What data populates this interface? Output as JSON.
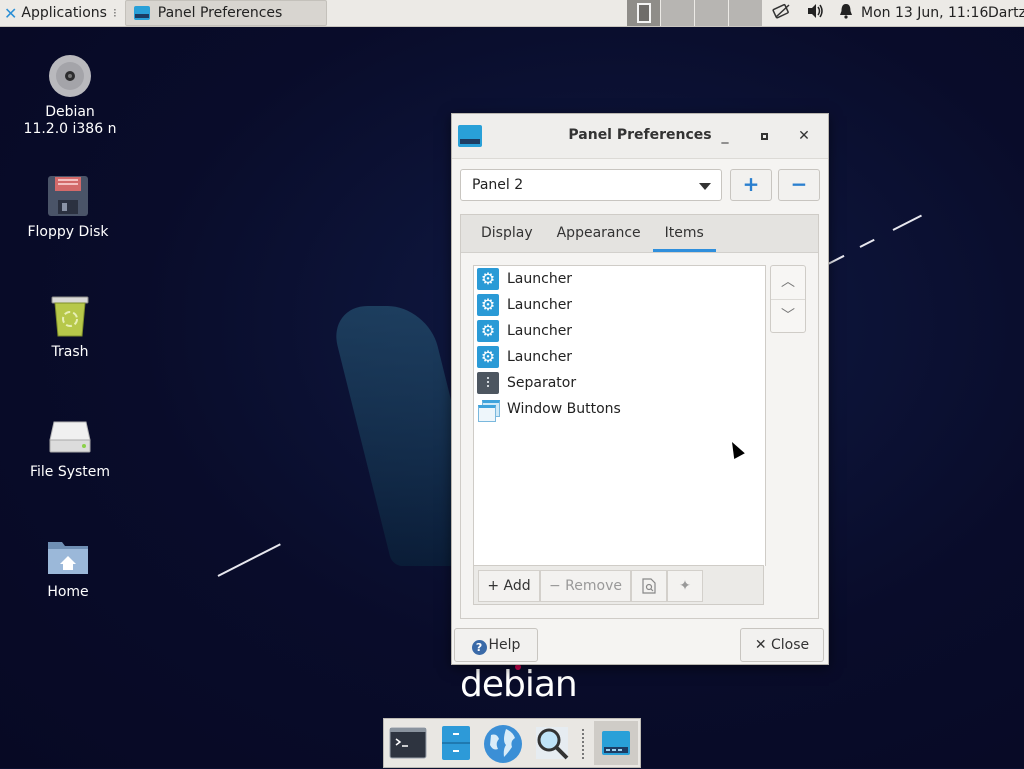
{
  "top_panel": {
    "applications_label": "Applications",
    "task_title": "Panel Preferences",
    "clock": "Mon 13 Jun, 11:16",
    "user": "Dartz",
    "tray_icons": [
      "network-icon",
      "volume-icon",
      "notification-bell-icon"
    ]
  },
  "desktop": {
    "icons": [
      {
        "label": "Debian\n11.2.0 i386 n",
        "icon": "disc-icon"
      },
      {
        "label": "Floppy Disk",
        "icon": "floppy-icon"
      },
      {
        "label": "Trash",
        "icon": "trash-icon"
      },
      {
        "label": "File System",
        "icon": "drive-icon"
      },
      {
        "label": "Home",
        "icon": "home-folder-icon"
      }
    ],
    "wallpaper_text": "debian"
  },
  "dialog": {
    "title": "Panel Preferences",
    "panel_select_value": "Panel 2",
    "add_panel_symbol": "+",
    "remove_panel_symbol": "−",
    "tabs": [
      {
        "label": "Display",
        "active": false
      },
      {
        "label": "Appearance",
        "active": false
      },
      {
        "label": "Items",
        "active": true
      }
    ],
    "items": [
      {
        "label": "Launcher",
        "icon": "launcher-gear-icon"
      },
      {
        "label": "Launcher",
        "icon": "launcher-gear-icon"
      },
      {
        "label": "Launcher",
        "icon": "launcher-gear-icon"
      },
      {
        "label": "Launcher",
        "icon": "launcher-gear-icon"
      },
      {
        "label": "Separator",
        "icon": "separator-icon"
      },
      {
        "label": "Window Buttons",
        "icon": "window-buttons-icon"
      }
    ],
    "list_toolbar": {
      "add_label": "Add",
      "remove_label": "Remove"
    },
    "help_label": "Help",
    "close_label": "Close"
  },
  "colors": {
    "accent": "#2f8fdc",
    "launcher_icon": "#2a9ad6",
    "wallpaper": "#0b0f2e"
  }
}
